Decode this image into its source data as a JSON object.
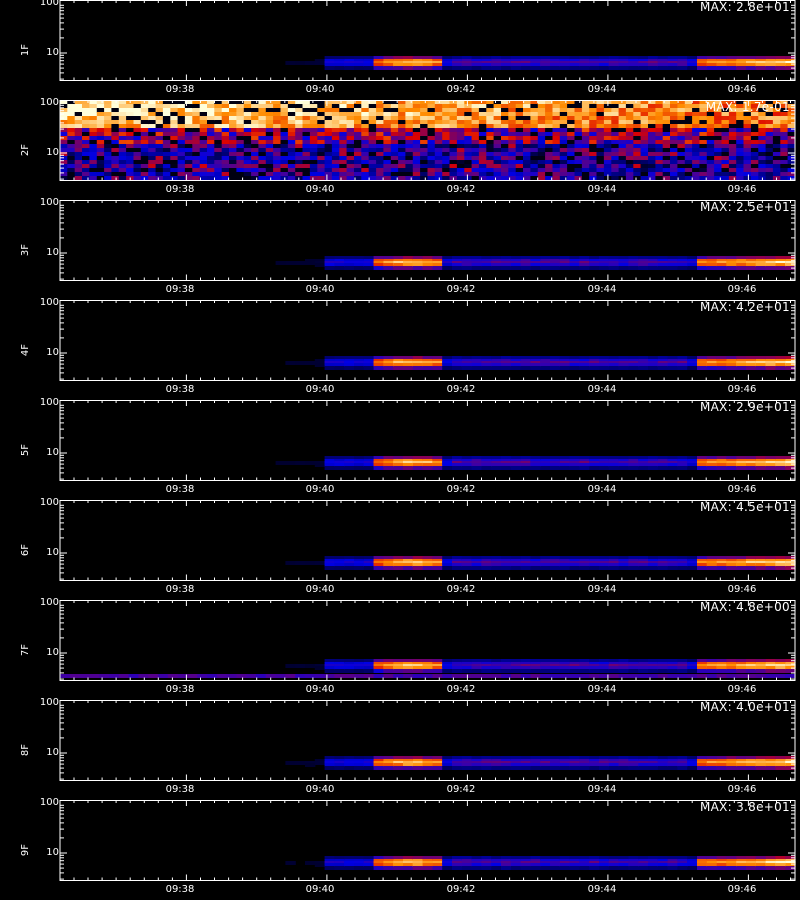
{
  "chart_data": {
    "type": "heatmap",
    "colormap": "black-blue-red-yellow-white",
    "x_ticks": [
      "09:38",
      "09:40",
      "09:42",
      "09:44",
      "09:46"
    ],
    "y_ticks": [
      "100",
      "10"
    ],
    "y_scale": "log",
    "panels": [
      {
        "label": "1F",
        "max": "MAX: 2.8e+01",
        "pattern": "band"
      },
      {
        "label": "2F",
        "max": "MAX: 1.7e-01",
        "pattern": "noise"
      },
      {
        "label": "3F",
        "max": "MAX: 2.5e+01",
        "pattern": "band"
      },
      {
        "label": "4F",
        "max": "MAX: 4.2e+01",
        "pattern": "band"
      },
      {
        "label": "5F",
        "max": "MAX: 2.9e+01",
        "pattern": "band"
      },
      {
        "label": "6F",
        "max": "MAX: 4.5e+01",
        "pattern": "band"
      },
      {
        "label": "7F",
        "max": "MAX: 4.8e+00",
        "pattern": "band7"
      },
      {
        "label": "8F",
        "max": "MAX: 4.0e+01",
        "pattern": "band"
      },
      {
        "label": "9F",
        "max": "MAX: 3.8e+01",
        "pattern": "band"
      }
    ]
  }
}
